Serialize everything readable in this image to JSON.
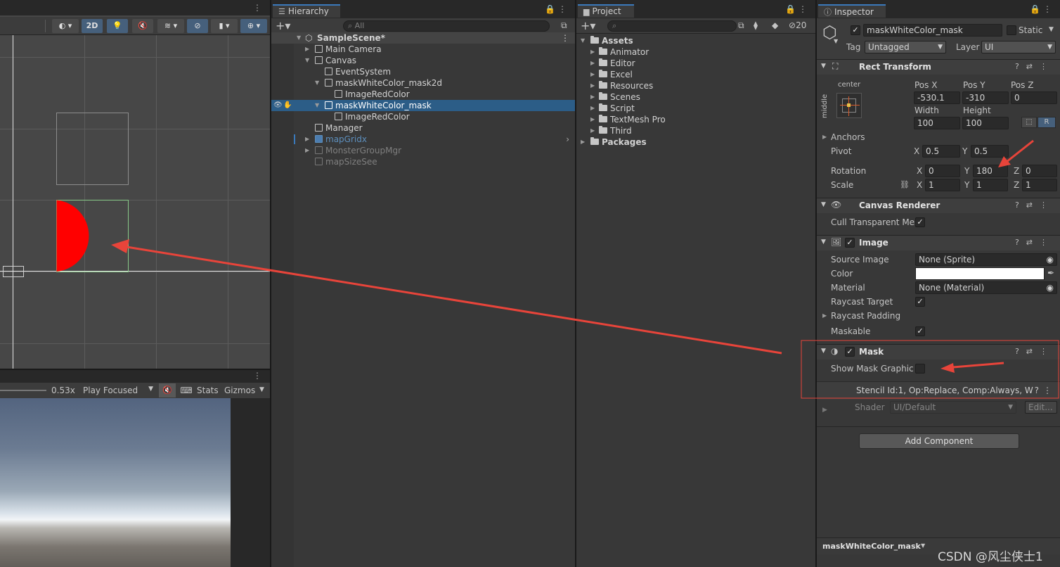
{
  "scene_toolbar": {
    "btn_2d": "2D"
  },
  "game_toolbar": {
    "scale": "0.53x",
    "play_mode": "Play Focused",
    "stats": "Stats",
    "gizmos": "Gizmos"
  },
  "hierarchy": {
    "tab": "Hierarchy",
    "search_placeholder": "All",
    "scene": "SampleScene*",
    "items": [
      "Main Camera",
      "Canvas",
      "EventSystem",
      "maskWhiteColor_mask2d",
      "ImageRedColor",
      "maskWhiteColor_mask",
      "ImageRedColor",
      "Manager",
      "mapGridx",
      "MonsterGroupMgr",
      "mapSizeSee"
    ]
  },
  "project": {
    "tab": "Project",
    "hidden_count": "20",
    "root": "Assets",
    "folders": [
      "Animator",
      "Editor",
      "Excel",
      "Resources",
      "Scenes",
      "Script",
      "TextMesh Pro",
      "Third"
    ],
    "packages": "Packages"
  },
  "inspector": {
    "tab": "Inspector",
    "object_name": "maskWhiteColor_mask",
    "static_label": "Static",
    "tag_label": "Tag",
    "tag_value": "Untagged",
    "layer_label": "Layer",
    "layer_value": "UI",
    "rect_transform": {
      "title": "Rect Transform",
      "anchor_h": "center",
      "anchor_v": "middle",
      "pos_x_label": "Pos X",
      "pos_y_label": "Pos Y",
      "pos_z_label": "Pos Z",
      "pos_x": "-530.1",
      "pos_y": "-310",
      "pos_z": "0",
      "width_label": "Width",
      "height_label": "Height",
      "width": "100",
      "height": "100",
      "r_btn": "R",
      "anchors": "Anchors",
      "pivot": "Pivot",
      "pivot_x": "0.5",
      "pivot_y": "0.5",
      "rotation": "Rotation",
      "rot_x": "0",
      "rot_y": "180",
      "rot_z": "0",
      "scale": "Scale",
      "scale_x": "1",
      "scale_y": "1",
      "scale_z": "1",
      "x": "X",
      "y": "Y",
      "z": "Z"
    },
    "canvas_renderer": {
      "title": "Canvas Renderer",
      "cull": "Cull Transparent Mes"
    },
    "image": {
      "title": "Image",
      "source_image_label": "Source Image",
      "source_image": "None (Sprite)",
      "color_label": "Color",
      "material_label": "Material",
      "material": "None (Material)",
      "raycast_target": "Raycast Target",
      "raycast_padding": "Raycast Padding",
      "maskable": "Maskable"
    },
    "mask": {
      "title": "Mask",
      "show_mask_graphic": "Show Mask Graphic",
      "stencil": "Stencil Id:1, Op:Replace, Comp:Always, W",
      "shader_label": "Shader",
      "shader": "UI/Default",
      "edit": "Edit..."
    },
    "add_component": "Add Component",
    "footer_name": "maskWhiteColor_mask"
  },
  "watermark": "CSDN @风尘侠士1",
  "colors": {
    "accent": "#3a79bb",
    "selection": "#2c5d87",
    "red_shape": "#ff0000",
    "annotation": "#e8443a"
  }
}
